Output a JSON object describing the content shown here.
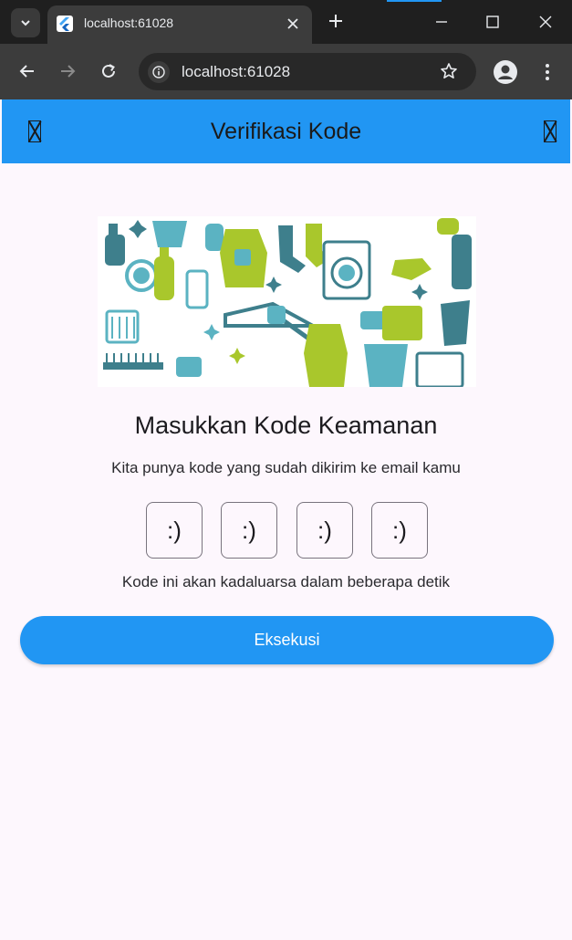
{
  "browser": {
    "tab_title": "localhost:61028",
    "url": "localhost:61028",
    "accent_color": "#2196f3"
  },
  "icons": {
    "tab_search": "chevron-down-icon",
    "tab_close": "close-icon",
    "new_tab": "plus-icon",
    "minimize": "minimize-icon",
    "maximize": "maximize-icon",
    "close_window": "close-icon",
    "back": "arrow-left-icon",
    "forward": "arrow-right-icon",
    "reload": "reload-icon",
    "site_info": "tune-icon",
    "bookmark": "star-icon",
    "profile": "account-icon",
    "menu": "kebab-menu-icon",
    "appbar_left": "missing-glyph-icon",
    "appbar_right": "missing-glyph-icon"
  },
  "appbar": {
    "title": "Verifikasi Kode",
    "background": "#2196f3"
  },
  "main": {
    "heading": "Masukkan Kode Keamanan",
    "subtext": "Kita punya kode yang sudah dikirim ke email kamu",
    "code_boxes": [
      ":)",
      ":)",
      ":)",
      ":)"
    ],
    "expire_text": "Kode ini akan kadaluarsa dalam beberapa detik",
    "button_label": "Eksekusi",
    "button_color": "#2196f3"
  }
}
